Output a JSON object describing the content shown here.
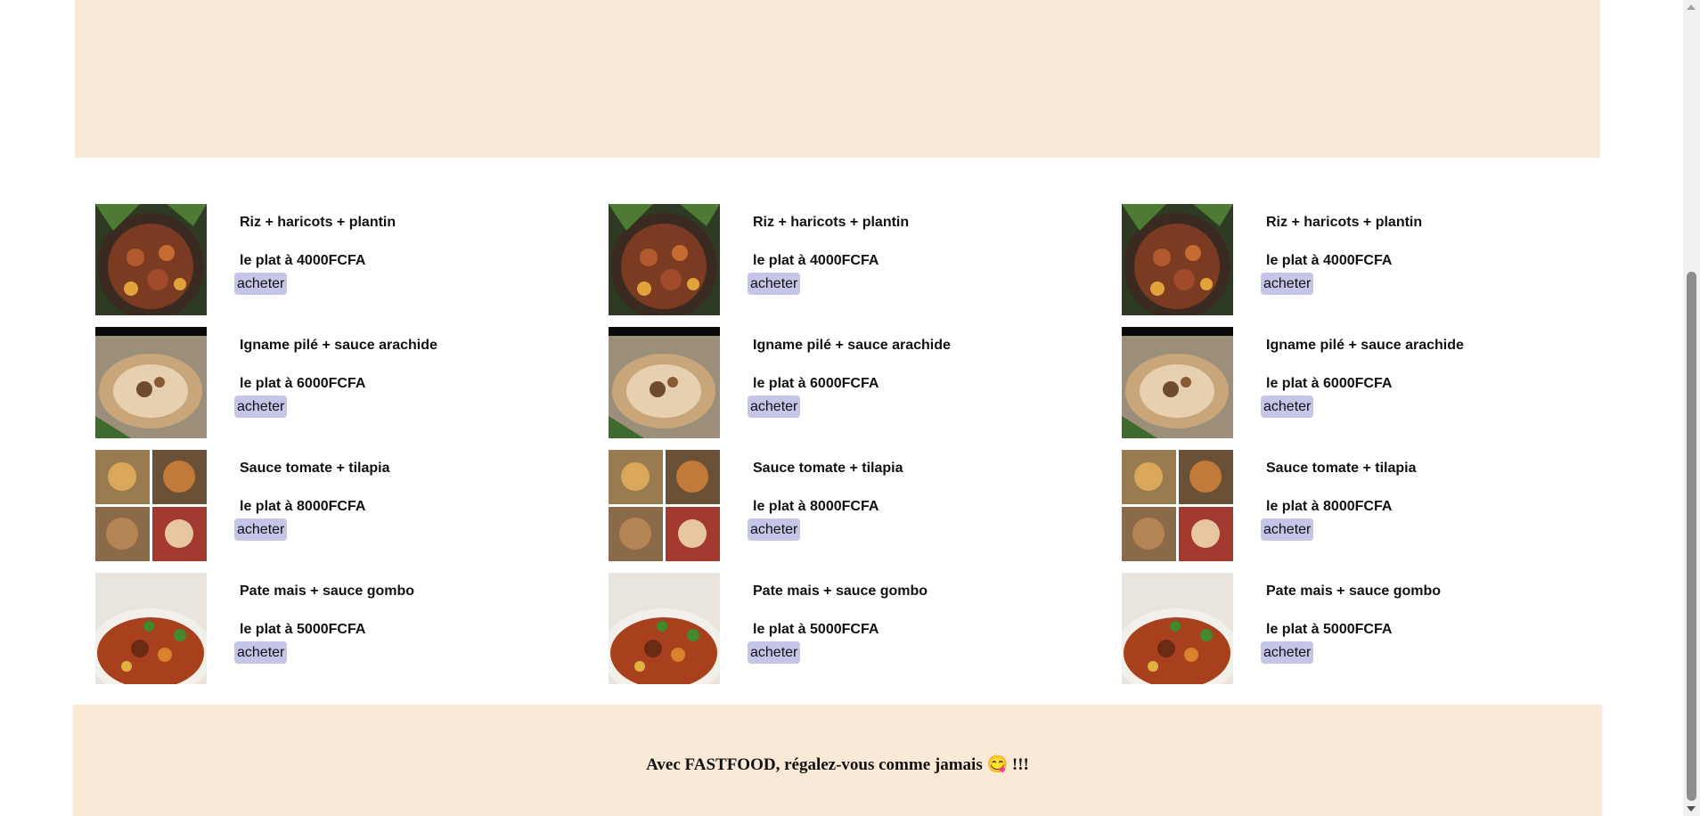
{
  "menu": {
    "columns": [
      {
        "items": [
          {
            "name": "Riz + haricots + plantin",
            "price": "le plat à 4000FCFA",
            "button": "acheter",
            "image": "rice-beans-plantain-photo"
          },
          {
            "name": "Igname pilé + sauce arachide",
            "price": "le plat à 6000FCFA",
            "button": "acheter",
            "image": "pounded-yam-peanut-sauce-photo"
          },
          {
            "name": "Sauce tomate + tilapia",
            "price": "le plat à 8000FCFA",
            "button": "acheter",
            "image": "tomato-sauce-tilapia-photo"
          },
          {
            "name": "Pate mais + sauce gombo",
            "price": "le plat à 5000FCFA",
            "button": "acheter",
            "image": "corn-paste-okra-sauce-photo"
          }
        ]
      },
      {
        "items": [
          {
            "name": "Riz + haricots + plantin",
            "price": "le plat à 4000FCFA",
            "button": "acheter",
            "image": "rice-beans-plantain-photo"
          },
          {
            "name": "Igname pilé + sauce arachide",
            "price": "le plat à 6000FCFA",
            "button": "acheter",
            "image": "pounded-yam-peanut-sauce-photo"
          },
          {
            "name": "Sauce tomate + tilapia",
            "price": "le plat à 8000FCFA",
            "button": "acheter",
            "image": "tomato-sauce-tilapia-photo"
          },
          {
            "name": "Pate mais + sauce gombo",
            "price": "le plat à 5000FCFA",
            "button": "acheter",
            "image": "corn-paste-okra-sauce-photo"
          }
        ]
      },
      {
        "items": [
          {
            "name": "Riz + haricots + plantin",
            "price": "le plat à 4000FCFA",
            "button": "acheter",
            "image": "rice-beans-plantain-photo"
          },
          {
            "name": "Igname pilé + sauce arachide",
            "price": "le plat à 6000FCFA",
            "button": "acheter",
            "image": "pounded-yam-peanut-sauce-photo"
          },
          {
            "name": "Sauce tomate + tilapia",
            "price": "le plat à 8000FCFA",
            "button": "acheter",
            "image": "tomato-sauce-tilapia-photo"
          },
          {
            "name": "Pate mais + sauce gombo",
            "price": "le plat à 5000FCFA",
            "button": "acheter",
            "image": "corn-paste-okra-sauce-photo"
          }
        ]
      }
    ]
  },
  "footer": {
    "text": "Avec FASTFOOD, régalez-vous comme jamais 😋 !!!"
  },
  "colors": {
    "banner_bg": "#f9ead8",
    "button_bg": "#c5c4e9",
    "text": "#111111"
  }
}
